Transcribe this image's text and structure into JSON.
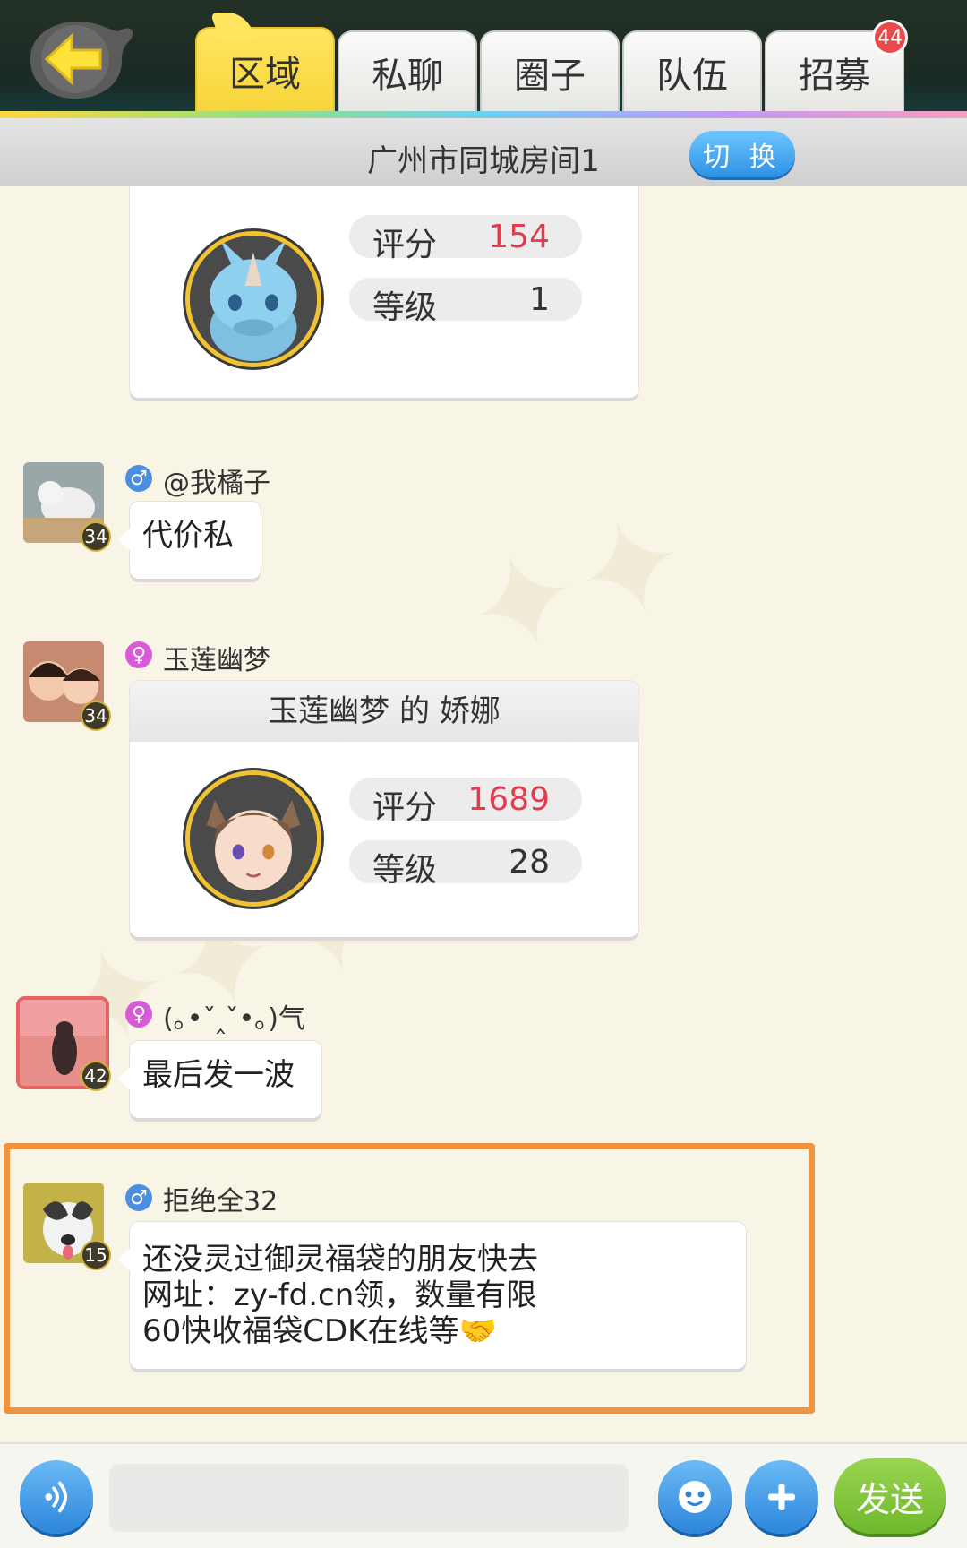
{
  "header": {
    "tabs": [
      {
        "label": "区域",
        "active": true
      },
      {
        "label": "私聊",
        "active": false
      },
      {
        "label": "圈子",
        "active": false
      },
      {
        "label": "队伍",
        "active": false
      },
      {
        "label": "招募",
        "active": false,
        "badge": "44"
      }
    ]
  },
  "room": {
    "title": "广州市同城房间1",
    "switch_label": "切 换"
  },
  "messages": [
    {
      "type": "pet_card",
      "stats": [
        {
          "key": "评分",
          "value": "154"
        },
        {
          "key": "等级",
          "value": "1"
        }
      ]
    },
    {
      "type": "text",
      "user": "@我橘子",
      "gender": "male",
      "level": "34",
      "text": "代价私"
    },
    {
      "type": "pet_card",
      "user": "玉莲幽梦",
      "gender": "female",
      "level": "34",
      "card_title": "玉莲幽梦 的 娇娜",
      "stats": [
        {
          "key": "评分",
          "value": "1689"
        },
        {
          "key": "等级",
          "value": "28"
        }
      ]
    },
    {
      "type": "text",
      "user": "(｡•ˇ‸ˇ•｡)气",
      "gender": "female",
      "level": "42",
      "text": "最后发一波"
    },
    {
      "type": "text",
      "user": "拒绝全32",
      "gender": "male",
      "level": "15",
      "lines": [
        "还没灵过御灵福袋的朋友快去",
        "网址：zy-fd.cn领，数量有限",
        "60快收福袋CDK在线等🤝"
      ]
    }
  ],
  "footer": {
    "input_value": "",
    "send_label": "发送"
  },
  "colors": {
    "accent_yellow": "#f7d43a",
    "highlight_orange": "#f09440",
    "send_green": "#6eb82c",
    "button_blue": "#2c86db"
  },
  "icons": {
    "back": "back-arrow-icon",
    "voice": "voice-icon",
    "emoji": "emoji-icon",
    "plus": "plus-icon"
  }
}
